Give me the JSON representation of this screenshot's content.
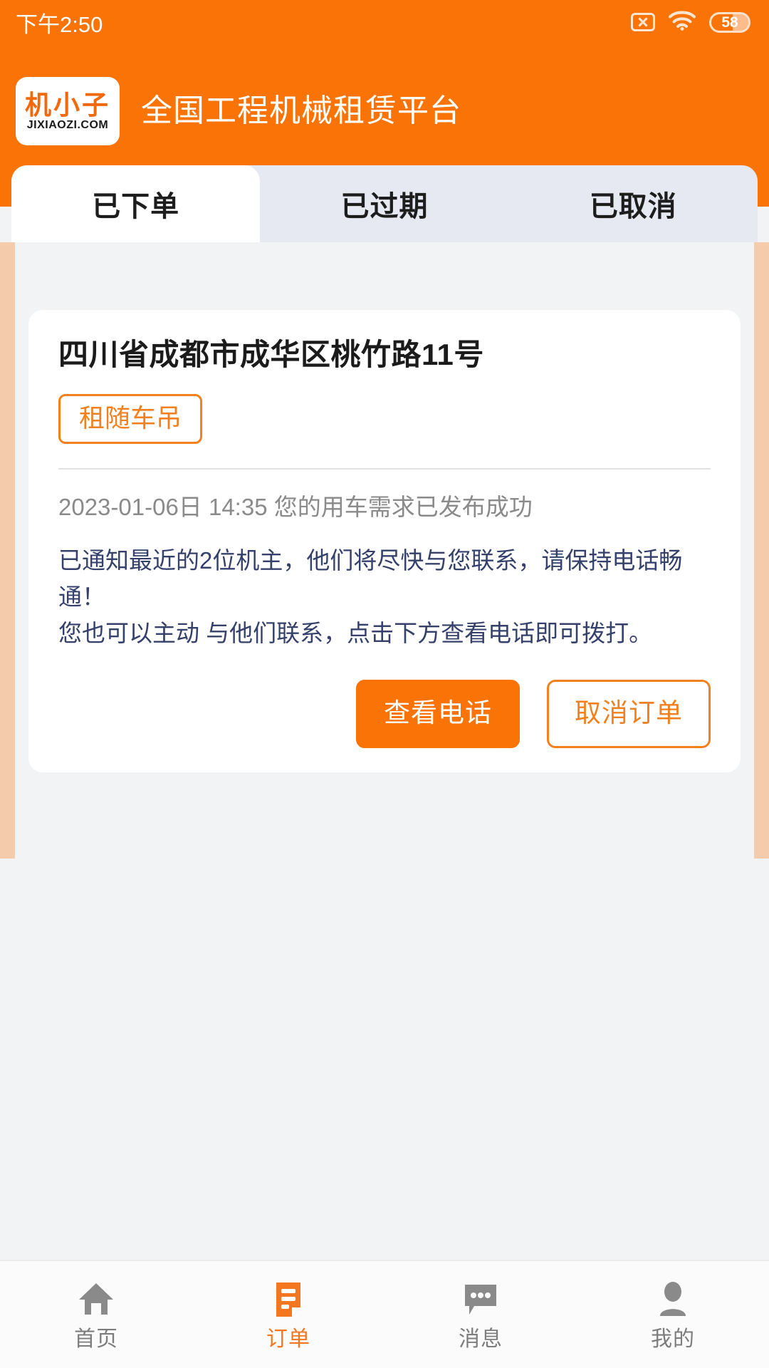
{
  "status_bar": {
    "time": "下午2:50",
    "sim_icon": "sim-disabled-icon",
    "wifi_icon": "wifi-icon",
    "battery_level": "58"
  },
  "header": {
    "logo_main": "机小子",
    "logo_sub": "JIXIAOZI.COM",
    "title": "全国工程机械租赁平台",
    "background_color": "#f97306"
  },
  "tabs": [
    {
      "label": "已下单",
      "active": true
    },
    {
      "label": "已过期",
      "active": false
    },
    {
      "label": "已取消",
      "active": false
    }
  ],
  "order_card": {
    "address": "四川省成都市成华区桃竹路11号",
    "tag": "租随车吊",
    "timestamp_line": "2023-01-06日 14:35 您的用车需求已发布成功",
    "description_line1": "已通知最近的2位机主，他们将尽快与您联系，请保持电话畅通！",
    "description_line2": "您也可以主动 与他们联系，点击下方查看电话即可拨打。",
    "primary_button": "查看电话",
    "secondary_button": "取消订单"
  },
  "bottom_nav": [
    {
      "label": "首页",
      "icon": "home-icon",
      "active": false
    },
    {
      "label": "订单",
      "icon": "order-document-icon",
      "active": true
    },
    {
      "label": "消息",
      "icon": "message-bubble-icon",
      "active": false
    },
    {
      "label": "我的",
      "icon": "user-profile-icon",
      "active": false
    }
  ],
  "colors": {
    "brand_orange": "#f97306",
    "accent_orange": "#f2801e",
    "page_background": "#f2f3f5",
    "tab_inactive_background": "#e6e9f2",
    "description_text": "#35416b"
  }
}
